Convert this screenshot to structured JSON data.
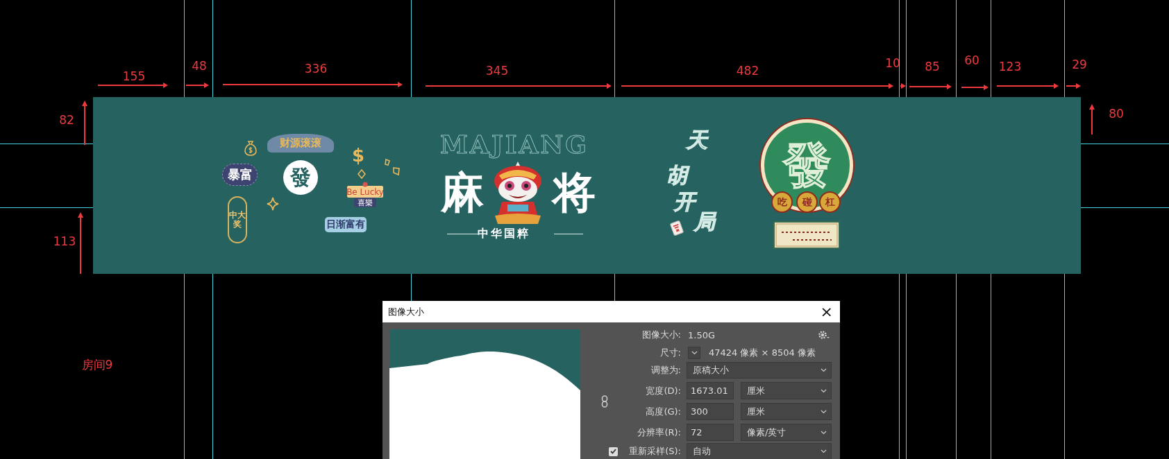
{
  "canvas": {
    "measurements": [
      "155",
      "48",
      "336",
      "345",
      "482",
      "10",
      "85",
      "60",
      "123",
      "29",
      "82",
      "80",
      "113"
    ],
    "room_label": "房间9",
    "banner": {
      "stickers": [
        {
          "kind": "arch",
          "text": "财源滚滚"
        },
        {
          "kind": "blob",
          "text": "暴富"
        },
        {
          "kind": "coin",
          "text": "發"
        },
        {
          "kind": "pill",
          "text": "中大奖"
        },
        {
          "kind": "symbol",
          "text": "$"
        },
        {
          "kind": "tag",
          "text": "Be Lucky"
        },
        {
          "kind": "label",
          "text": "喜樂"
        },
        {
          "kind": "plaque",
          "text": "日渐富有"
        }
      ],
      "title_en": "MAJIANG",
      "title_left": "麻",
      "title_right": "将",
      "subtitle": "中华国粹",
      "slogan": [
        "天",
        "胡",
        "开",
        "局"
      ],
      "emblem": {
        "text": "發",
        "chips": [
          "吃",
          "碰",
          "杠"
        ]
      }
    }
  },
  "dialog": {
    "title": "图像大小",
    "close": "×",
    "image_size": {
      "label": "图像大小:",
      "value": "1.50G"
    },
    "dimensions": {
      "label": "尺寸:",
      "value": "47424 像素 × 8504 像素"
    },
    "fit_to": {
      "label": "调整为:",
      "value": "原稿大小"
    },
    "fields": [
      {
        "label": "宽度(D):",
        "value": "1673.01",
        "unit": "厘米"
      },
      {
        "label": "高度(G):",
        "value": "300",
        "unit": "厘米"
      },
      {
        "label": "分辨率(R):",
        "value": "72",
        "unit": "像素/英寸"
      }
    ],
    "resample": {
      "label": "重新采样(S):",
      "checked": true,
      "value": "自动"
    }
  }
}
